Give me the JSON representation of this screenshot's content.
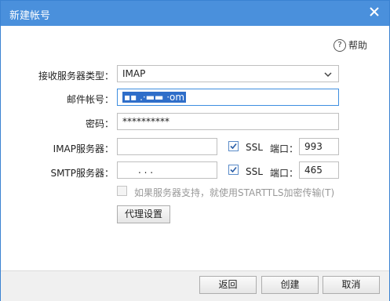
{
  "window": {
    "title": "新建帐号"
  },
  "help": {
    "label": "帮助"
  },
  "form": {
    "server_type_label": "接收服务器类型：",
    "server_type_value": "IMAP",
    "account_label": "邮件帐号：",
    "account_value": "▪▪ .·▬▬ ·om",
    "password_label": "密码：",
    "password_value": "**********",
    "imap_label": "IMAP服务器：",
    "imap_value": "",
    "imap_ssl_label": "SSL",
    "imap_port_label": "端口：",
    "imap_port_value": "993",
    "smtp_label": "SMTP服务器：",
    "smtp_value": ". . .",
    "smtp_ssl_label": "SSL",
    "smtp_port_label": "端口：",
    "smtp_port_value": "465",
    "starttls_label": "如果服务器支持，就使用STARTTLS加密传输(T)",
    "proxy_button": "代理设置"
  },
  "footer": {
    "back": "返回",
    "create": "创建",
    "cancel": "取消"
  }
}
